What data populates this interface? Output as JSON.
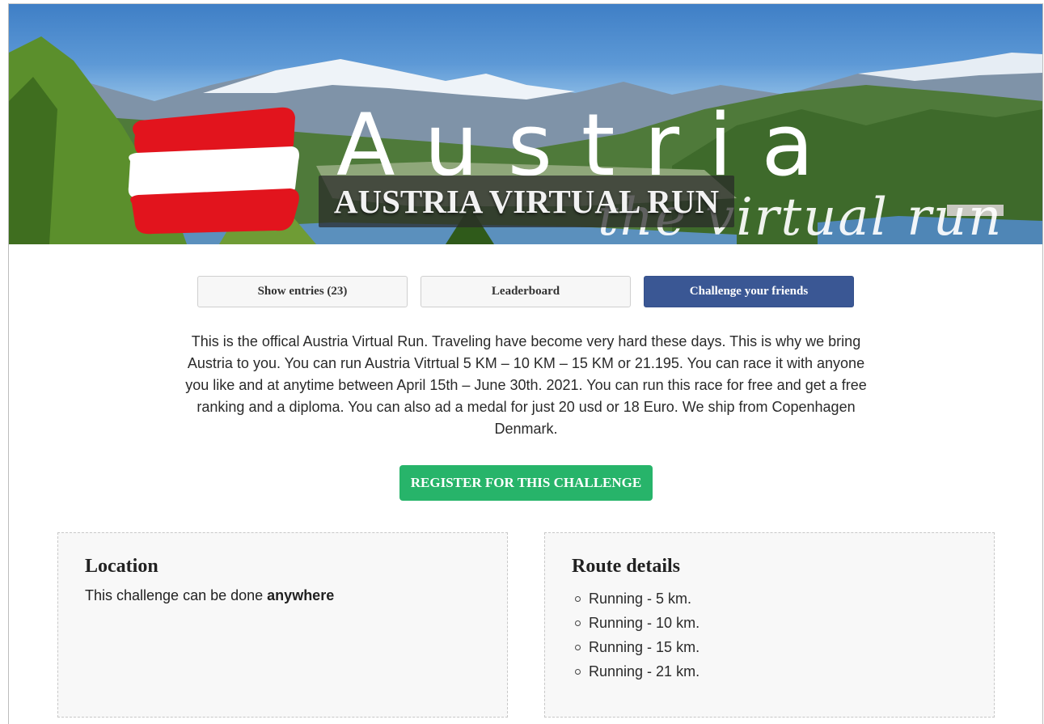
{
  "banner": {
    "script_title": "Austria",
    "script_subtitle": "the virtual run",
    "title": "AUSTRIA VIRTUAL RUN"
  },
  "tabs": [
    {
      "label": "Show entries (23)"
    },
    {
      "label": "Leaderboard"
    },
    {
      "label": "Challenge your friends"
    }
  ],
  "description": "This is the offical Austria Virtual Run. Traveling have become very hard these days. This is why we bring Austria to you. You can run Austria Vitrtual 5 KM – 10 KM – 15 KM or 21.195. You can race it with anyone you like and at anytime between April 15th – June 30th. 2021. You can run this race for free and get a free ranking and a diploma. You can also ad a medal for just 20 usd or 18 Euro. We ship from Copenhagen Denmark.",
  "register_label": "REGISTER FOR THIS CHALLENGE",
  "location": {
    "heading": "Location",
    "text_prefix": "This challenge can be done ",
    "text_bold": "anywhere"
  },
  "route": {
    "heading": "Route details",
    "items": [
      "Running - 5 km.",
      "Running - 10 km.",
      "Running - 15 km.",
      "Running - 21 km."
    ]
  },
  "colors": {
    "primary_button": "#3a5794",
    "register_button": "#27b46a",
    "flag_red": "#e2141d"
  }
}
